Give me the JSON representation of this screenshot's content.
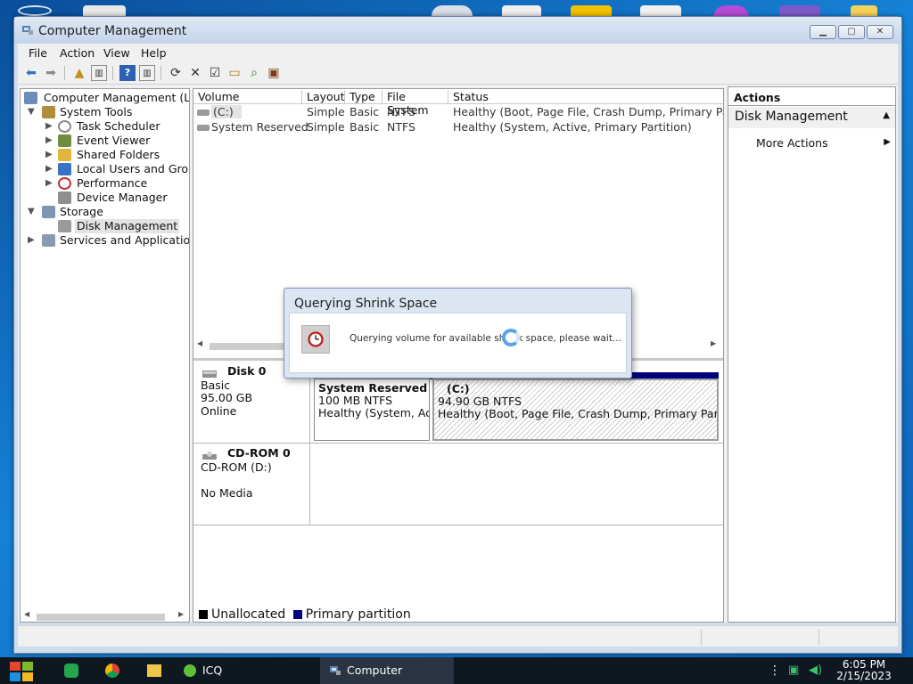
{
  "window": {
    "title": "Computer Management"
  },
  "menubar": {
    "items": [
      "File",
      "Action",
      "View",
      "Help"
    ]
  },
  "tree": {
    "root": "Computer Management (Loca",
    "items": [
      {
        "label": "System Tools"
      },
      {
        "label": "Task Scheduler"
      },
      {
        "label": "Event Viewer"
      },
      {
        "label": "Shared Folders"
      },
      {
        "label": "Local Users and Group"
      },
      {
        "label": "Performance"
      },
      {
        "label": "Device Manager"
      },
      {
        "label": "Storage"
      },
      {
        "label": "Disk Management"
      },
      {
        "label": "Services and Applications"
      }
    ]
  },
  "volumes": {
    "columns": [
      "Volume",
      "Layout",
      "Type",
      "File System",
      "Status"
    ],
    "rows": [
      {
        "volume": "(C:)",
        "layout": "Simple",
        "type": "Basic",
        "fs": "NTFS",
        "status": "Healthy (Boot, Page File, Crash Dump, Primary Partition)"
      },
      {
        "volume": "System Reserved",
        "layout": "Simple",
        "type": "Basic",
        "fs": "NTFS",
        "status": "Healthy (System, Active, Primary Partition)"
      }
    ]
  },
  "disks": [
    {
      "name": "Disk 0",
      "kind": "Basic",
      "size": "95.00 GB",
      "state": "Online",
      "partitions": [
        {
          "name": "System Reserved",
          "size": "100 MB NTFS",
          "status": "Healthy (System, Act"
        },
        {
          "name": "(C:)",
          "size": "94.90 GB NTFS",
          "status": "Healthy (Boot, Page File, Crash Dump, Primary Partition)"
        }
      ]
    },
    {
      "name": "CD-ROM 0",
      "kind": "CD-ROM (D:)",
      "state": "No Media"
    }
  ],
  "legend": {
    "unallocated": "Unallocated",
    "primary": "Primary partition"
  },
  "actions": {
    "title": "Actions",
    "section": "Disk Management",
    "more": "More Actions"
  },
  "dialog": {
    "title": "Querying Shrink Space",
    "message": "Querying volume for available shrink space, please wait..."
  },
  "taskbar": {
    "icq": "ICQ",
    "active_window": "Computer Manage...",
    "time": "6:05 PM",
    "date": "2/15/2023"
  },
  "colors": {
    "unallocated": "#000000",
    "primary_partition": "#00007c",
    "taskbar": "#0f1721"
  }
}
